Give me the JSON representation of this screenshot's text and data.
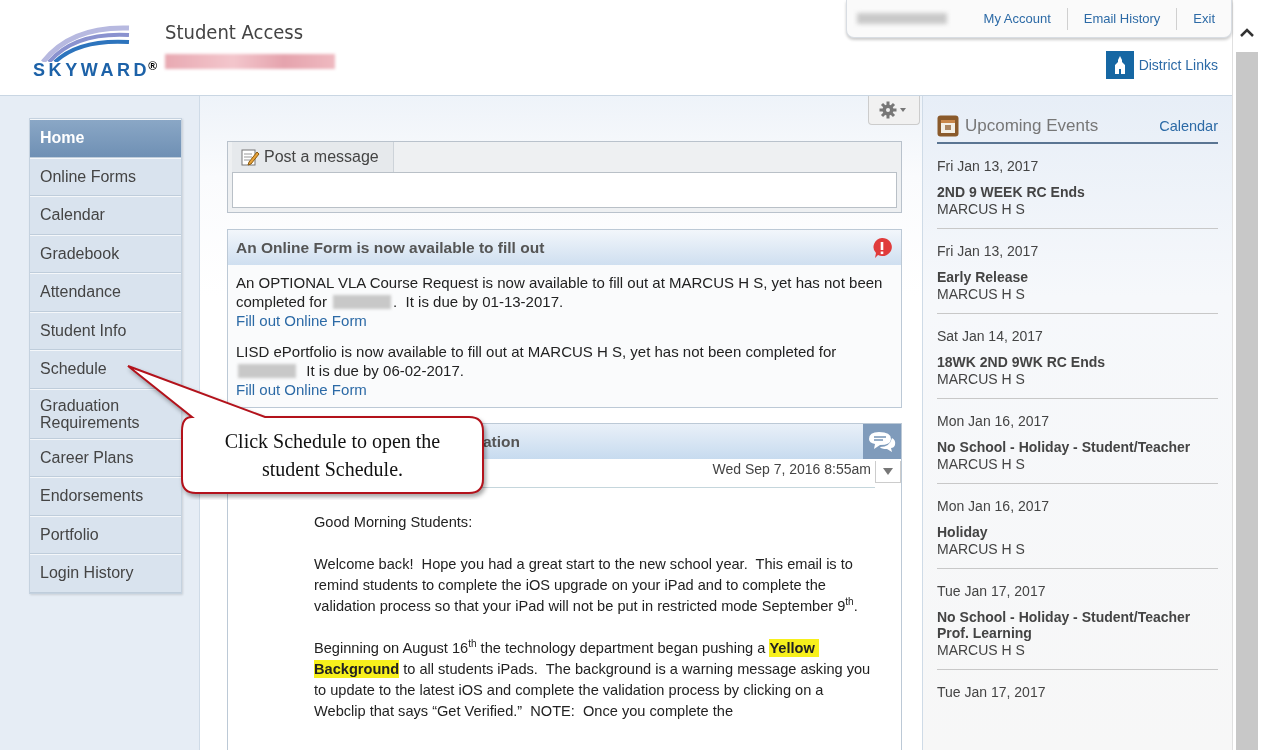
{
  "header": {
    "logo_text": "SKYWARD",
    "logo_mark": "®",
    "title": "Student Access",
    "links": [
      "My Account",
      "Email History",
      "Exit"
    ],
    "district_links": "District Links"
  },
  "nav": [
    {
      "label": "Home",
      "selected": true
    },
    {
      "label": "Online Forms",
      "selected": false
    },
    {
      "label": "Calendar",
      "selected": false
    },
    {
      "label": "Gradebook",
      "selected": false
    },
    {
      "label": "Attendance",
      "selected": false
    },
    {
      "label": "Student Info",
      "selected": false
    },
    {
      "label": "Schedule",
      "selected": false
    },
    {
      "label": "Graduation Requirements",
      "selected": false
    },
    {
      "label": "Career Plans",
      "selected": false
    },
    {
      "label": "Endorsements",
      "selected": false
    },
    {
      "label": "Portfolio",
      "selected": false
    },
    {
      "label": "Login History",
      "selected": false
    }
  ],
  "post": {
    "tab": "Post a message"
  },
  "form_notice": {
    "title": "An Online Form is now available to fill out",
    "items": [
      {
        "text_before": "An OPTIONAL VLA Course Request is now available to fill out at MARCUS H S, yet has not been completed for",
        "text_after": ".  It is due by 01-13-2017.",
        "link": "Fill out Online Form"
      },
      {
        "text_before": "LISD ePortfolio is now available to fill out at MARCUS H S, yet has not been completed for",
        "text_after": "  It is due by 06-02-2017.",
        "link": "Fill out Online Form"
      }
    ]
  },
  "announcement": {
    "title": "ation",
    "date": "Wed Sep 7, 2016 8:55am",
    "paragraphs": [
      "Good Morning Students:",
      "Welcome back!  Hope you had a great start to the new school year.  This email is to remind students to complete the iOS upgrade on your iPad and to complete the validation process so that your iPad will not be put in restricted mode September 9$^{th}$.",
      "Beginning on August 16$^{th}$ the technology department began pushing a **Yellow Background** to all students iPads.  The background is a warning message asking you to update to the latest iOS and complete the validation process by clicking on a Webclip that says “Get Verified.”  NOTE:  Once you complete the"
    ]
  },
  "events": {
    "title": "Upcoming Events",
    "link": "Calendar",
    "items": [
      {
        "date": "Fri Jan 13, 2017",
        "title": "2ND 9 WEEK RC Ends",
        "school": "MARCUS H S"
      },
      {
        "date": "Fri Jan 13, 2017",
        "title": "Early Release",
        "school": "MARCUS H S"
      },
      {
        "date": "Sat Jan 14, 2017",
        "title": "18WK 2ND 9WK RC Ends",
        "school": "MARCUS H S"
      },
      {
        "date": "Mon Jan 16, 2017",
        "title": "No School - Holiday - Student/Teacher",
        "school": "MARCUS H S"
      },
      {
        "date": "Mon Jan 16, 2017",
        "title": "Holiday",
        "school": "MARCUS H S"
      },
      {
        "date": "Tue Jan 17, 2017",
        "title": "No School - Holiday - Student/Teacher Prof. Learning",
        "school": "MARCUS H S"
      },
      {
        "date": "Tue Jan 17, 2017"
      }
    ]
  },
  "callout": {
    "text": "Click Schedule to open the student Schedule."
  }
}
